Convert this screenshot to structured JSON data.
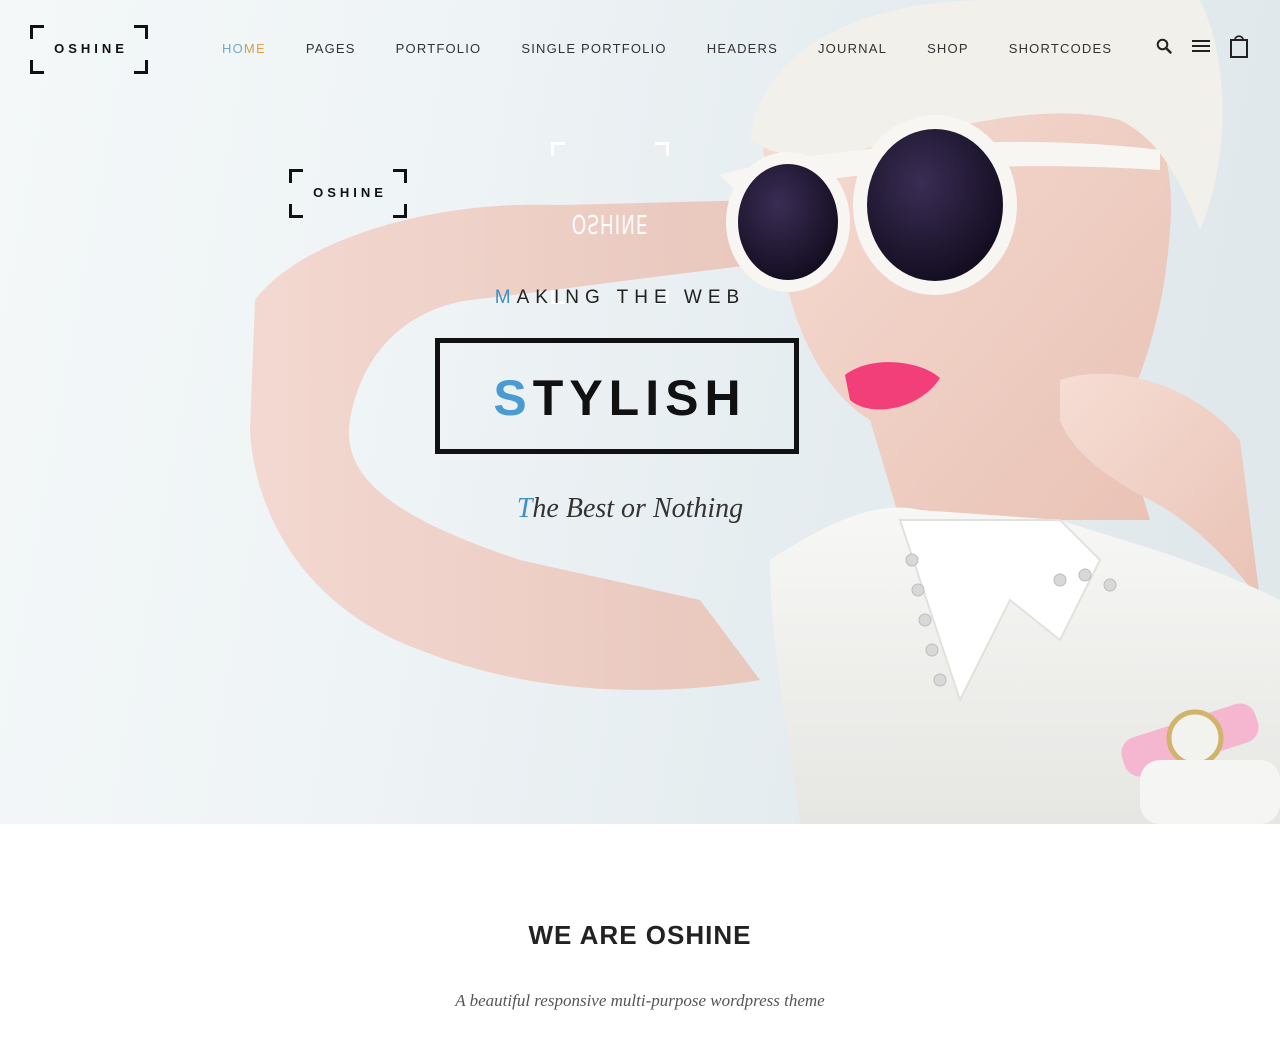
{
  "brand": {
    "logo_text": "OSHINE"
  },
  "nav": {
    "items": [
      {
        "label": "HOME",
        "active": true
      },
      {
        "label": "PAGES"
      },
      {
        "label": "PORTFOLIO"
      },
      {
        "label": "SINGLE PORTFOLIO"
      },
      {
        "label": "HEADERS"
      },
      {
        "label": "JOURNAL"
      },
      {
        "label": "SHOP"
      },
      {
        "label": "SHORTCODES"
      }
    ],
    "icons": [
      "search-icon",
      "menu-icon",
      "cart-icon"
    ]
  },
  "hero": {
    "small_logo_text": "OSHINE",
    "mirrored_logo_text": "OSHINE",
    "tagline_first": "M",
    "tagline_rest": "AKING THE WEB",
    "headline_first": "S",
    "headline_rest": "TYLISH",
    "motto_first": "T",
    "motto_rest": "he Best or Nothing"
  },
  "about": {
    "title": "WE ARE OSHINE",
    "subtitle": "A beautiful responsive multi-purpose wordpress theme"
  },
  "colors": {
    "accent_blue": "#3d8fc5",
    "nav_active_orange": "#e0a24c",
    "text_dark": "#111111"
  }
}
